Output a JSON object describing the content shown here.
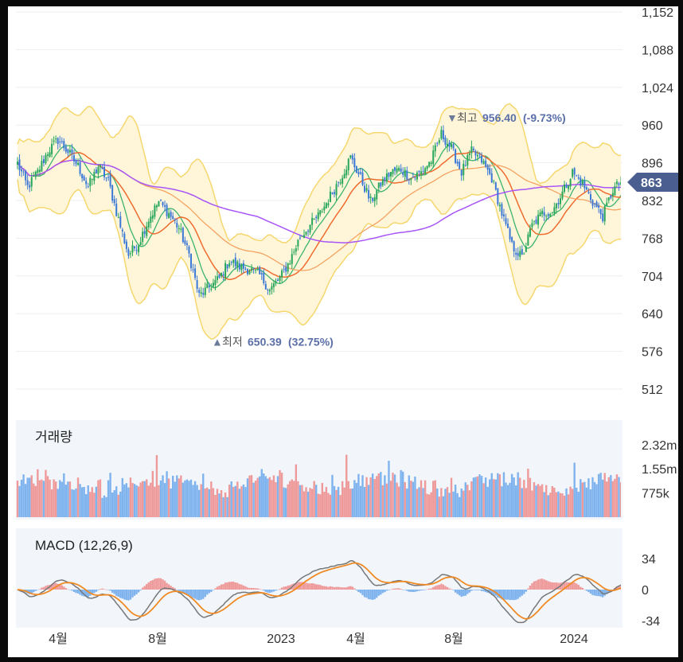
{
  "chart_data": [
    {
      "type": "candlestick",
      "panel": "price",
      "y_ticks": [
        "1,152",
        "1,088",
        "1,024",
        "960",
        "896",
        "832",
        "768",
        "704",
        "640",
        "576",
        "512"
      ],
      "y_tick_values": [
        1152,
        1088,
        1024,
        960,
        896,
        832,
        768,
        704,
        640,
        576,
        512
      ],
      "ylim": [
        490,
        1160
      ],
      "grid": true,
      "current_price": "863",
      "current_value": 863,
      "annotations": {
        "high": {
          "label": "최고",
          "value_text": "956.40",
          "pct_text": "(-9.73%)",
          "value": 956.4
        },
        "low": {
          "label": "최저",
          "value_text": "650.39",
          "pct_text": "(32.75%)",
          "value": 650.39
        }
      },
      "close_anchors": [
        {
          "i": 0,
          "v": 895
        },
        {
          "i": 5,
          "v": 855
        },
        {
          "i": 10,
          "v": 880
        },
        {
          "i": 15,
          "v": 915
        },
        {
          "i": 20,
          "v": 935
        },
        {
          "i": 25,
          "v": 915
        },
        {
          "i": 30,
          "v": 890
        },
        {
          "i": 35,
          "v": 855
        },
        {
          "i": 40,
          "v": 890
        },
        {
          "i": 45,
          "v": 865
        },
        {
          "i": 50,
          "v": 800
        },
        {
          "i": 55,
          "v": 740
        },
        {
          "i": 60,
          "v": 760
        },
        {
          "i": 65,
          "v": 800
        },
        {
          "i": 70,
          "v": 830
        },
        {
          "i": 75,
          "v": 810
        },
        {
          "i": 80,
          "v": 785
        },
        {
          "i": 85,
          "v": 740
        },
        {
          "i": 90,
          "v": 670
        },
        {
          "i": 95,
          "v": 685
        },
        {
          "i": 100,
          "v": 700
        },
        {
          "i": 105,
          "v": 730
        },
        {
          "i": 110,
          "v": 720
        },
        {
          "i": 115,
          "v": 715
        },
        {
          "i": 120,
          "v": 705
        },
        {
          "i": 125,
          "v": 680
        },
        {
          "i": 130,
          "v": 700
        },
        {
          "i": 135,
          "v": 730
        },
        {
          "i": 140,
          "v": 770
        },
        {
          "i": 145,
          "v": 790
        },
        {
          "i": 150,
          "v": 810
        },
        {
          "i": 155,
          "v": 840
        },
        {
          "i": 160,
          "v": 870
        },
        {
          "i": 165,
          "v": 905
        },
        {
          "i": 170,
          "v": 870
        },
        {
          "i": 175,
          "v": 830
        },
        {
          "i": 180,
          "v": 860
        },
        {
          "i": 185,
          "v": 880
        },
        {
          "i": 190,
          "v": 885
        },
        {
          "i": 195,
          "v": 870
        },
        {
          "i": 200,
          "v": 880
        },
        {
          "i": 205,
          "v": 900
        },
        {
          "i": 210,
          "v": 945
        },
        {
          "i": 215,
          "v": 920
        },
        {
          "i": 220,
          "v": 880
        },
        {
          "i": 225,
          "v": 915
        },
        {
          "i": 230,
          "v": 900
        },
        {
          "i": 235,
          "v": 870
        },
        {
          "i": 240,
          "v": 810
        },
        {
          "i": 245,
          "v": 755
        },
        {
          "i": 250,
          "v": 735
        },
        {
          "i": 255,
          "v": 790
        },
        {
          "i": 260,
          "v": 810
        },
        {
          "i": 265,
          "v": 815
        },
        {
          "i": 270,
          "v": 845
        },
        {
          "i": 275,
          "v": 880
        },
        {
          "i": 280,
          "v": 860
        },
        {
          "i": 285,
          "v": 830
        },
        {
          "i": 290,
          "v": 805
        },
        {
          "i": 295,
          "v": 850
        },
        {
          "i": 299,
          "v": 863
        }
      ],
      "n_candles": 300,
      "up_color": "#26a65b",
      "down_color": "#3a78d8",
      "band_fill": "#fff6d9",
      "band_line": "#f5d76e",
      "ma_colors": [
        "#ef6c2f",
        "#f4a261",
        "#a855f7"
      ]
    },
    {
      "type": "bar",
      "panel": "volume",
      "title": "거래량",
      "y_ticks": [
        "2.32m",
        "1.55m",
        "775k"
      ],
      "y_tick_values": [
        2320000,
        1550000,
        775000
      ],
      "ylim": [
        0,
        2800000
      ],
      "up_color": "#ef9a9a",
      "down_color": "#7fb3ee"
    },
    {
      "type": "line",
      "panel": "macd",
      "title": "MACD (12,26,9)",
      "y_ticks": [
        "34",
        "0",
        "-34"
      ],
      "y_tick_values": [
        34,
        0,
        -34
      ],
      "ylim": [
        -40,
        40
      ],
      "series": [
        {
          "color": "#777777"
        },
        {
          "color": "#f08a24"
        }
      ],
      "hist_up": "#ef9a9a",
      "hist_down": "#7fb3ee"
    }
  ],
  "x_axis": {
    "labels": [
      "4월",
      "8월",
      "2023",
      "4월",
      "8월",
      "2024"
    ],
    "positions_idx": [
      20,
      65,
      125,
      160,
      205,
      265
    ]
  }
}
